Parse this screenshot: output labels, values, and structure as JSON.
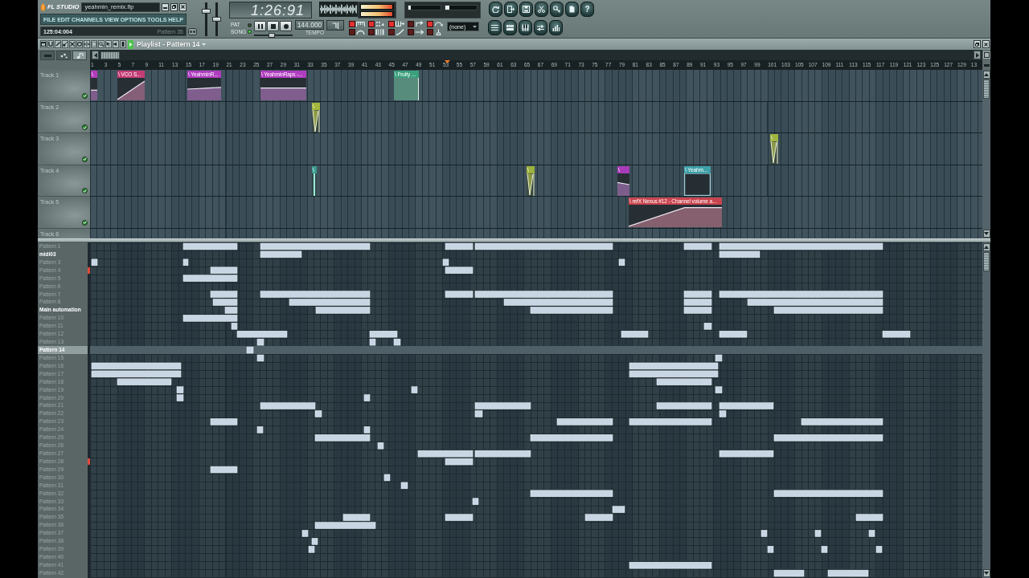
{
  "toolbar": {
    "logo": "FL STUDIO",
    "filename": "yeahmin_remix.flp",
    "menu": [
      "FILE",
      "EDIT",
      "CHANNELS",
      "VIEW",
      "OPTIONS",
      "TOOLS",
      "HELP"
    ],
    "hint_position": "125:04:004",
    "hint_text": "Pattern 35",
    "master_volume": {
      "level": 0.78
    },
    "master_pitch": {
      "level": 0.5
    },
    "time": "1:26:91",
    "modes": [
      {
        "label": "PAT",
        "selected": false
      },
      {
        "label": "SONG",
        "selected": true
      }
    ],
    "transport": [
      {
        "kind": "pause"
      },
      {
        "kind": "stop"
      },
      {
        "kind": "record"
      }
    ],
    "song_position": {
      "level": 0.45
    },
    "tempo": "144.000",
    "tempo_label": "TEMPO",
    "peak_meters": [
      {
        "level": 0.97
      },
      {
        "level": 0.97
      }
    ],
    "cpu_meters": [
      {
        "level": 0.08
      },
      {
        "level": 0.14
      }
    ],
    "record_options": [
      {
        "upper_on": true,
        "lower_on": false
      },
      {
        "upper_on": true,
        "lower_on": false
      },
      {
        "upper_on": true,
        "lower_on": false
      },
      {
        "upper_on": false,
        "lower_on": false
      },
      {
        "upper_on": true,
        "lower_on": false
      }
    ],
    "pattern_selector": "(none)",
    "help_label": "?"
  },
  "playlist": {
    "title": "Playlist - Pattern 14",
    "view_tabs": [
      {
        "selected": false
      },
      {
        "selected": false
      },
      {
        "selected": true
      }
    ],
    "ruler": [
      "1",
      "3",
      "5",
      "7",
      "9",
      "11",
      "13",
      "15",
      "17",
      "19",
      "21",
      "23",
      "25",
      "27",
      "29",
      "31",
      "33",
      "35",
      "37",
      "39",
      "41",
      "43",
      "45",
      "47",
      "49",
      "51",
      "53",
      "55",
      "57",
      "59",
      "61",
      "63",
      "65",
      "67",
      "69",
      "71",
      "73",
      "75",
      "77",
      "79",
      "81",
      "83",
      "85",
      "87",
      "89",
      "91",
      "93",
      "95",
      "97",
      "99",
      "101",
      "103",
      "105",
      "107",
      "109",
      "111",
      "113",
      "115",
      "117",
      "119",
      "121",
      "123",
      "125",
      "127",
      "129",
      "13"
    ],
    "tracks": [
      {
        "name": "Track 1",
        "enabled": true,
        "clips": [
          {
            "label": "\\",
            "color": "#b43cbc"
          },
          {
            "label": "\\ VCO S...",
            "color": "#c43c74"
          },
          {
            "label": "\\ YeahminR...",
            "color": "#b03cc0"
          },
          {
            "label": "\\ YeahminRaps -...",
            "color": "#b03cc0"
          },
          {
            "label": "\\ Fruity ...",
            "color": "#3aa07c"
          }
        ]
      },
      {
        "name": "Track 2",
        "enabled": true,
        "clips": [
          {
            "label": "\\",
            "color": "#a6b83c"
          }
        ]
      },
      {
        "name": "Track 3",
        "enabled": true,
        "clips": [
          {
            "label": "\\",
            "color": "#a0b440"
          }
        ]
      },
      {
        "name": "Track 4",
        "enabled": true,
        "clips": [
          {
            "label": "\\",
            "color": "#3c9c90"
          },
          {
            "label": "\\",
            "color": "#9cb03c"
          },
          {
            "label": "\\",
            "color": "#a83cb8"
          },
          {
            "label": "\\ Yeahm...",
            "color": "#3ea0a8"
          }
        ]
      },
      {
        "name": "Track 5",
        "enabled": true,
        "clips": [
          {
            "label": "\\ refX Nexus #12 - Channel volume a...",
            "color": "#c8444e"
          }
        ]
      },
      {
        "name": "Track 6"
      }
    ],
    "patterns": [
      {
        "name": "Pattern 1",
        "selected": false,
        "renamed": false,
        "marked": false
      },
      {
        "name": "midi03",
        "selected": false,
        "renamed": true,
        "marked": false
      },
      {
        "name": "Pattern 3",
        "selected": false,
        "renamed": false,
        "marked": false
      },
      {
        "name": "Pattern 4",
        "selected": false,
        "renamed": false,
        "marked": true
      },
      {
        "name": "Pattern 5",
        "selected": false,
        "renamed": false,
        "marked": false
      },
      {
        "name": "Pattern 6",
        "selected": false,
        "renamed": false,
        "marked": false
      },
      {
        "name": "Pattern 7",
        "selected": false,
        "renamed": false,
        "marked": false
      },
      {
        "name": "Pattern 8",
        "selected": false,
        "renamed": false,
        "marked": false
      },
      {
        "name": "Main automation",
        "selected": false,
        "renamed": true,
        "marked": false
      },
      {
        "name": "Pattern 10",
        "selected": false,
        "renamed": false,
        "marked": false
      },
      {
        "name": "Pattern 11",
        "selected": false,
        "renamed": false,
        "marked": false
      },
      {
        "name": "Pattern 12",
        "selected": false,
        "renamed": false,
        "marked": false
      },
      {
        "name": "Pattern 13",
        "selected": false,
        "renamed": false,
        "marked": false
      },
      {
        "name": "Pattern 14",
        "selected": true,
        "renamed": false,
        "marked": false
      },
      {
        "name": "Pattern 15",
        "selected": false,
        "renamed": false,
        "marked": false
      },
      {
        "name": "Pattern 16",
        "selected": false,
        "renamed": false,
        "marked": false
      },
      {
        "name": "Pattern 17",
        "selected": false,
        "renamed": false,
        "marked": false
      },
      {
        "name": "Pattern 18",
        "selected": false,
        "renamed": false,
        "marked": false
      },
      {
        "name": "Pattern 19",
        "selected": false,
        "renamed": false,
        "marked": false
      },
      {
        "name": "Pattern 20",
        "selected": false,
        "renamed": false,
        "marked": false
      },
      {
        "name": "Pattern 21",
        "selected": false,
        "renamed": false,
        "marked": false
      },
      {
        "name": "Pattern 22",
        "selected": false,
        "renamed": false,
        "marked": false
      },
      {
        "name": "Pattern 23",
        "selected": false,
        "renamed": false,
        "marked": false
      },
      {
        "name": "Pattern 24",
        "selected": false,
        "renamed": false,
        "marked": false
      },
      {
        "name": "Pattern 25",
        "selected": false,
        "renamed": false,
        "marked": false
      },
      {
        "name": "Pattern 26",
        "selected": false,
        "renamed": false,
        "marked": false
      },
      {
        "name": "Pattern 27",
        "selected": false,
        "renamed": false,
        "marked": false
      },
      {
        "name": "Pattern 28",
        "selected": false,
        "renamed": false,
        "marked": true
      },
      {
        "name": "Pattern 29",
        "selected": false,
        "renamed": false,
        "marked": false
      },
      {
        "name": "Pattern 30",
        "selected": false,
        "renamed": false,
        "marked": false
      },
      {
        "name": "Pattern 31",
        "selected": false,
        "renamed": false,
        "marked": false
      },
      {
        "name": "Pattern 32",
        "selected": false,
        "renamed": false,
        "marked": false
      },
      {
        "name": "Pattern 33",
        "selected": false,
        "renamed": false,
        "marked": false
      },
      {
        "name": "Pattern 34",
        "selected": false,
        "renamed": false,
        "marked": false
      },
      {
        "name": "Pattern 35",
        "selected": false,
        "renamed": false,
        "marked": false
      },
      {
        "name": "Pattern 36",
        "selected": false,
        "renamed": false,
        "marked": false
      },
      {
        "name": "Pattern 37",
        "selected": false,
        "renamed": false,
        "marked": false
      },
      {
        "name": "Pattern 38",
        "selected": false,
        "renamed": false,
        "marked": false
      },
      {
        "name": "Pattern 39",
        "selected": false,
        "renamed": false,
        "marked": false
      },
      {
        "name": "Pattern 40",
        "selected": false,
        "renamed": false,
        "marked": false
      },
      {
        "name": "Pattern 41",
        "selected": false,
        "renamed": false,
        "marked": false
      },
      {
        "name": "Pattern 42",
        "selected": false,
        "renamed": false,
        "marked": false
      }
    ]
  }
}
